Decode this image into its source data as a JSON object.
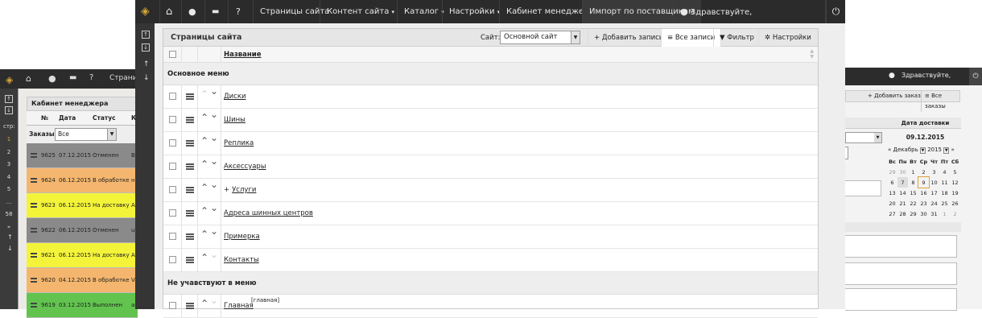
{
  "topbar": {
    "nav": [
      "Страницы сайта",
      "Контент сайта",
      "Каталог",
      "Настройки",
      "Кабинет менеджера",
      "Импорт по поставщикам"
    ],
    "greeting": "Здравствуйте,"
  },
  "sidebar": {
    "up": "↑",
    "down": "↓"
  },
  "panel": {
    "title": "Страницы сайта",
    "site_label": "Сайт:",
    "site_value": "Основной сайт",
    "add": "Добавить запись",
    "all": "Все записи",
    "filter": "Фильтр",
    "settings": "Настройки",
    "col_name": "Название"
  },
  "sections": [
    {
      "title": "Основное меню",
      "items": [
        {
          "name": "Диски",
          "prefix": ""
        },
        {
          "name": "Шины",
          "prefix": ""
        },
        {
          "name": "Реплика",
          "prefix": ""
        },
        {
          "name": "Аксессуары",
          "prefix": ""
        },
        {
          "name": "Услуги",
          "prefix": "+"
        },
        {
          "name": "Адреса шинных центров",
          "prefix": ""
        },
        {
          "name": "Примерка",
          "prefix": ""
        },
        {
          "name": "Контакты",
          "prefix": ""
        }
      ]
    },
    {
      "title": "Не учавствуют в меню",
      "items": [
        {
          "name": "Главная",
          "tag": "[главная]"
        }
      ]
    }
  ],
  "back_left": {
    "nav": "Страниц",
    "panel_title": "Кабинет менеджера",
    "cols": [
      "№",
      "Дата",
      "Статус",
      "К"
    ],
    "filter_label": "Заказы:",
    "filter_value": "Все",
    "pages_label": "стр:",
    "pages": [
      "1",
      "2",
      "3",
      "4",
      "5",
      "...",
      "58",
      "»"
    ],
    "rows": [
      {
        "id": "9625",
        "date": "07.12.2015",
        "status": "Отменен",
        "x": "Вс",
        "color": "#8a8a8a"
      },
      {
        "id": "9624",
        "date": "06.12.2015",
        "status": "В обработке",
        "x": "на",
        "color": "#f4b66e"
      },
      {
        "id": "9623",
        "date": "06.12.2015",
        "status": "На доставку",
        "x": "Ак",
        "color": "#f3f33a"
      },
      {
        "id": "9622",
        "date": "06.12.2015",
        "status": "Отменен",
        "x": "us",
        "color": "#8a8a8a"
      },
      {
        "id": "9621",
        "date": "06.12.2015",
        "status": "На доставку",
        "x": "Ал",
        "color": "#f3f33a"
      },
      {
        "id": "9620",
        "date": "04.12.2015",
        "status": "В обработке",
        "x": "Va",
        "color": "#f4b66e"
      },
      {
        "id": "9619",
        "date": "03.12.2015",
        "status": "Выполнен",
        "x": "ан",
        "color": "#62c44f"
      }
    ]
  },
  "back_right": {
    "greeting": "Здравствуйте,",
    "add": "Добавить заказ",
    "all": "Все заказы",
    "delivery_label": "Дата доставки",
    "delivery_date": "09.12.2015",
    "month": "Декабрь",
    "year": "2015",
    "weekdays": [
      "Вс",
      "Пн",
      "Вт",
      "Ср",
      "Чт",
      "Пт",
      "Сб"
    ],
    "weeks": [
      [
        "29",
        "30",
        "1",
        "2",
        "3",
        "4",
        "5"
      ],
      [
        "6",
        "7",
        "8",
        "9",
        "10",
        "11",
        "12"
      ],
      [
        "13",
        "14",
        "15",
        "16",
        "17",
        "18",
        "19"
      ],
      [
        "20",
        "21",
        "22",
        "23",
        "24",
        "25",
        "26"
      ],
      [
        "27",
        "28",
        "29",
        "30",
        "31",
        "1",
        "2"
      ]
    ]
  }
}
